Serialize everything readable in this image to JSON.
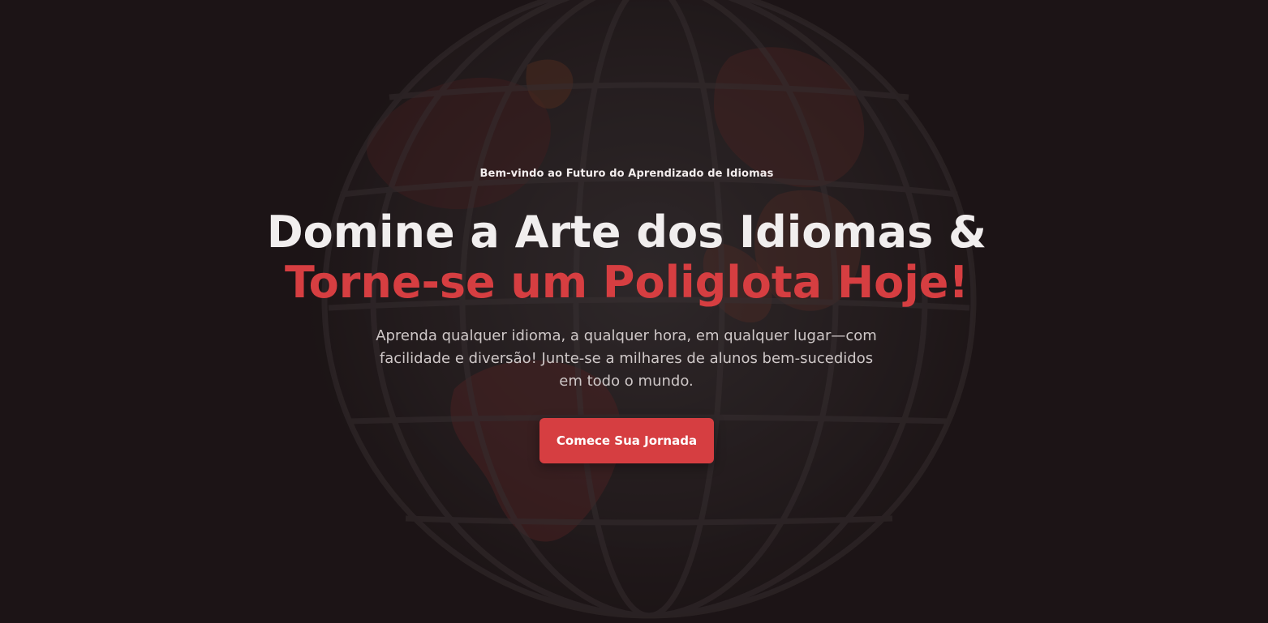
{
  "hero": {
    "eyebrow": "Bem-vindo ao Futuro do Aprendizado de Idiomas",
    "headline_line1": "Domine a Arte dos Idiomas &",
    "headline_line2": "Torne-se um Poliglota Hoje!",
    "subtitle": "Aprenda qualquer idioma, a qualquer hora, em qualquer lugar—com facilidade e diversão! Junte-se a milhares de alunos bem-sucedidos em todo o mundo.",
    "cta_label": "Comece Sua Jornada",
    "background_image": "globe-illustration"
  },
  "colors": {
    "background": "#1c1516",
    "accent": "#d63e41",
    "headline": "#f1eeee",
    "subtitle": "#cfc8c8"
  }
}
